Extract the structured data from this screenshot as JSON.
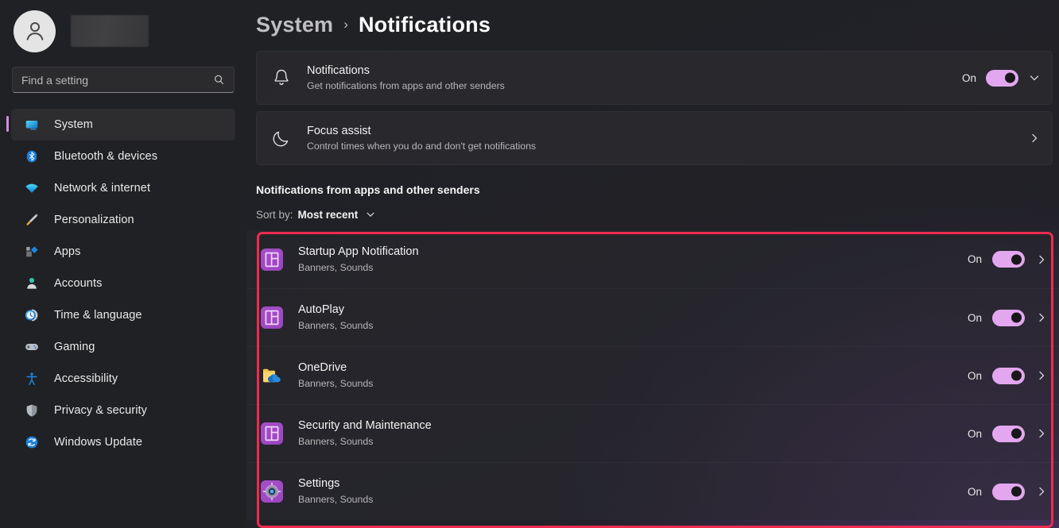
{
  "window": {
    "app_name": "Settings"
  },
  "profile": {
    "avatar_icon": "person-avatar-icon",
    "name_redacted": true
  },
  "search": {
    "placeholder": "Find a setting",
    "value": "",
    "icon": "search-icon"
  },
  "sidebar": {
    "items": [
      {
        "label": "System",
        "icon": "system-monitor-icon",
        "active": true
      },
      {
        "label": "Bluetooth & devices",
        "icon": "bluetooth-icon",
        "active": false
      },
      {
        "label": "Network & internet",
        "icon": "wifi-icon",
        "active": false
      },
      {
        "label": "Personalization",
        "icon": "paintbrush-icon",
        "active": false
      },
      {
        "label": "Apps",
        "icon": "apps-icon",
        "active": false
      },
      {
        "label": "Accounts",
        "icon": "account-person-icon",
        "active": false
      },
      {
        "label": "Time & language",
        "icon": "clock-icon",
        "active": false
      },
      {
        "label": "Gaming",
        "icon": "gamepad-icon",
        "active": false
      },
      {
        "label": "Accessibility",
        "icon": "accessibility-icon",
        "active": false
      },
      {
        "label": "Privacy & security",
        "icon": "shield-icon",
        "active": false
      },
      {
        "label": "Windows Update",
        "icon": "update-refresh-icon",
        "active": false
      }
    ]
  },
  "breadcrumb": {
    "parent": "System",
    "separator": "›",
    "current": "Notifications"
  },
  "cards": [
    {
      "title": "Notifications",
      "subtitle": "Get notifications from apps and other senders",
      "icon": "bell-icon",
      "state_label": "On",
      "toggle_on": true,
      "trailing_icon": "chevron-down-icon"
    },
    {
      "title": "Focus assist",
      "subtitle": "Control times when you do and don't get notifications",
      "icon": "moon-icon",
      "state_label": "",
      "toggle_on": null,
      "trailing_icon": "chevron-right-icon"
    }
  ],
  "section": {
    "heading": "Notifications from apps and other senders",
    "sort_label": "Sort by:",
    "sort_value": "Most recent",
    "sort_icon": "chevron-down-icon"
  },
  "apps": [
    {
      "name": "Startup App Notification",
      "detail": "Banners, Sounds",
      "icon": "window-tile-app-icon",
      "state_label": "On",
      "toggle_on": true,
      "trailing_icon": "chevron-right-icon"
    },
    {
      "name": "AutoPlay",
      "detail": "Banners, Sounds",
      "icon": "window-tile-app-icon",
      "state_label": "On",
      "toggle_on": true,
      "trailing_icon": "chevron-right-icon"
    },
    {
      "name": "OneDrive",
      "detail": "Banners, Sounds",
      "icon": "onedrive-folder-cloud-icon",
      "state_label": "On",
      "toggle_on": true,
      "trailing_icon": "chevron-right-icon"
    },
    {
      "name": "Security and Maintenance",
      "detail": "Banners, Sounds",
      "icon": "window-tile-app-icon",
      "state_label": "On",
      "toggle_on": true,
      "trailing_icon": "chevron-right-icon"
    },
    {
      "name": "Settings",
      "detail": "Banners, Sounds",
      "icon": "settings-gear-app-icon",
      "state_label": "On",
      "toggle_on": true,
      "trailing_icon": "chevron-right-icon"
    }
  ],
  "annotations": {
    "arrow": {
      "icon": "red-arrow-right",
      "color": "#ef2b4e",
      "points_to": "notifications-toggle"
    },
    "highlight_box": {
      "color": "#ef2b4e",
      "surrounds": "app-notification-list"
    }
  },
  "colors": {
    "accent_toggle": "#e2a7ee",
    "accent_selection": "#d489e8",
    "annotation_red": "#ef2b4e",
    "app_icon_purple": "#a74fc9",
    "background": "#202124"
  }
}
